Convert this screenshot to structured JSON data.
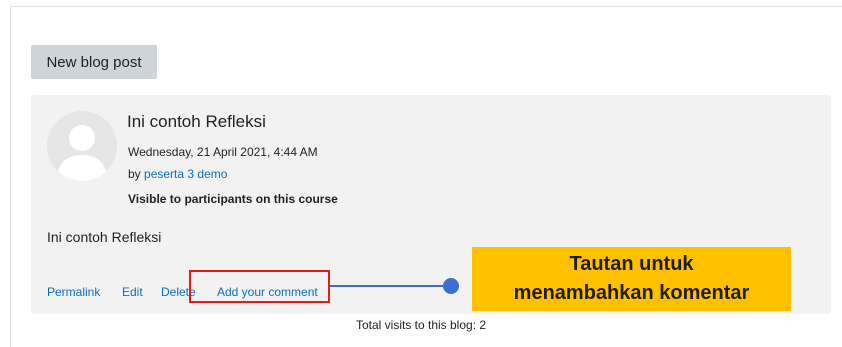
{
  "toolbar": {
    "new_post_label": "New blog post"
  },
  "post": {
    "title": "Ini contoh Refleksi",
    "date": "Wednesday, 21 April 2021, 4:44 AM",
    "author_prefix": "by",
    "author_name": "peserta 3 demo",
    "visibility": "Visible to participants on this course",
    "body": "Ini contoh Refleksi",
    "avatar_icon": "user-avatar-icon"
  },
  "actions": {
    "permalink": "Permalink",
    "edit": "Edit",
    "delete": "Delete",
    "add_comment": "Add your comment"
  },
  "annotation": {
    "line1": "Tautan untuk",
    "line2": "menambahkan komentar",
    "highlight_color": "#e81a1a",
    "connector_color": "#3b6fd4",
    "callout_color": "#ffc000"
  },
  "footer": {
    "visits": "Total visits to this blog: 2"
  },
  "colors": {
    "link": "#0f6cbf",
    "card_bg": "#f2f2f2",
    "button_bg": "#ced4da"
  }
}
